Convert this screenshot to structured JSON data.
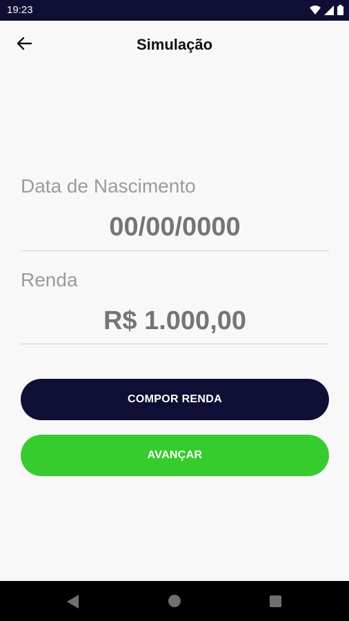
{
  "status_bar": {
    "time": "19:23",
    "icons": [
      "wifi-icon",
      "signal-icon",
      "battery-icon"
    ]
  },
  "app_bar": {
    "back_icon": "arrow-left-icon",
    "title": "Simulação"
  },
  "form": {
    "birth_date": {
      "label": "Data de Nascimento",
      "placeholder": "00/00/0000",
      "value": ""
    },
    "income": {
      "label": "Renda",
      "placeholder": "R$ 1.000,00",
      "value": ""
    }
  },
  "buttons": {
    "compose_income": "COMPOR RENDA",
    "advance": "AVANÇAR"
  },
  "nav_bar": {
    "icons": [
      "nav-back-icon",
      "nav-home-icon",
      "nav-recents-icon"
    ]
  },
  "colors": {
    "primary_dark": "#0f0f35",
    "accent_green": "#36cc2e",
    "background": "#f8f8f8",
    "label_gray": "#9b9b9b",
    "placeholder_gray": "#d7d7d7"
  }
}
